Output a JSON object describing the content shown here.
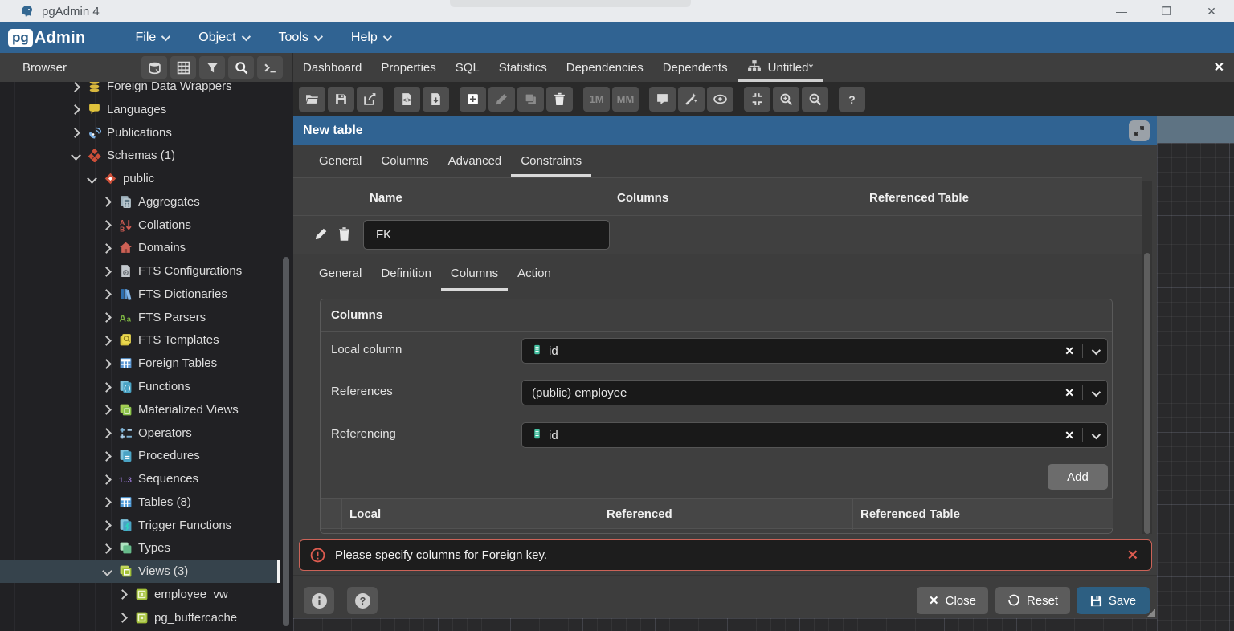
{
  "window": {
    "title": "pgAdmin 4",
    "controls": [
      "minimize",
      "restore",
      "close"
    ]
  },
  "menubar": {
    "logo_pg": "pg",
    "logo_admin": "Admin",
    "menus": [
      "File",
      "Object",
      "Tools",
      "Help"
    ]
  },
  "browser": {
    "title": "Browser",
    "toolbar_icons": [
      "storage-manager-icon",
      "query-table-icon",
      "filter-icon",
      "search-objects-icon",
      "query-tool-icon"
    ],
    "tree": [
      {
        "label": "Foreign Data Wrappers",
        "level": 0,
        "state": "collapsed",
        "icon": "fdw-icon"
      },
      {
        "label": "Languages",
        "level": 0,
        "state": "collapsed",
        "icon": "language-icon"
      },
      {
        "label": "Publications",
        "level": 0,
        "state": "collapsed",
        "icon": "publication-icon"
      },
      {
        "label": "Schemas (1)",
        "level": 0,
        "state": "expanded",
        "icon": "schemas-icon"
      },
      {
        "label": "public",
        "level": 1,
        "state": "expanded",
        "icon": "schema-icon"
      },
      {
        "label": "Aggregates",
        "level": 2,
        "state": "collapsed",
        "icon": "aggregate-icon"
      },
      {
        "label": "Collations",
        "level": 2,
        "state": "collapsed",
        "icon": "collation-icon"
      },
      {
        "label": "Domains",
        "level": 2,
        "state": "collapsed",
        "icon": "domain-icon"
      },
      {
        "label": "FTS Configurations",
        "level": 2,
        "state": "collapsed",
        "icon": "fts-configuration-icon"
      },
      {
        "label": "FTS Dictionaries",
        "level": 2,
        "state": "collapsed",
        "icon": "fts-dictionary-icon"
      },
      {
        "label": "FTS Parsers",
        "level": 2,
        "state": "collapsed",
        "icon": "fts-parser-icon"
      },
      {
        "label": "FTS Templates",
        "level": 2,
        "state": "collapsed",
        "icon": "fts-template-icon"
      },
      {
        "label": "Foreign Tables",
        "level": 2,
        "state": "collapsed",
        "icon": "foreign-table-icon"
      },
      {
        "label": "Functions",
        "level": 2,
        "state": "collapsed",
        "icon": "function-icon"
      },
      {
        "label": "Materialized Views",
        "level": 2,
        "state": "collapsed",
        "icon": "matview-icon"
      },
      {
        "label": "Operators",
        "level": 2,
        "state": "collapsed",
        "icon": "operator-icon"
      },
      {
        "label": "Procedures",
        "level": 2,
        "state": "collapsed",
        "icon": "procedure-icon"
      },
      {
        "label": "Sequences",
        "level": 2,
        "state": "collapsed",
        "icon": "sequence-icon"
      },
      {
        "label": "Tables (8)",
        "level": 2,
        "state": "collapsed",
        "icon": "table-icon"
      },
      {
        "label": "Trigger Functions",
        "level": 2,
        "state": "collapsed",
        "icon": "trigger-function-icon"
      },
      {
        "label": "Types",
        "level": 2,
        "state": "collapsed",
        "icon": "type-icon"
      },
      {
        "label": "Views (3)",
        "level": 2,
        "state": "expanded",
        "icon": "view-collection-icon",
        "selected": true
      },
      {
        "label": "employee_vw",
        "level": 3,
        "state": "collapsed",
        "icon": "view-icon"
      },
      {
        "label": "pg_buffercache",
        "level": 3,
        "state": "collapsed",
        "icon": "view-icon"
      }
    ]
  },
  "main_tabs": {
    "tabs": [
      {
        "label": "Dashboard"
      },
      {
        "label": "Properties"
      },
      {
        "label": "SQL"
      },
      {
        "label": "Statistics"
      },
      {
        "label": "Dependencies"
      },
      {
        "label": "Dependents"
      },
      {
        "label": "Untitled*",
        "active": true,
        "icon": "erd-icon"
      }
    ],
    "close_label": "✕"
  },
  "erd_toolbar": [
    {
      "name": "open-file-icon"
    },
    {
      "name": "save-icon"
    },
    {
      "name": "share-icon",
      "gap_after": true
    },
    {
      "name": "sql-file-icon"
    },
    {
      "name": "download-image-icon",
      "gap_after": true
    },
    {
      "name": "add-table-icon"
    },
    {
      "name": "edit-table-icon",
      "disabled": true
    },
    {
      "name": "clone-table-icon",
      "disabled": true
    },
    {
      "name": "drop-table-icon",
      "gap_after": true
    },
    {
      "name": "one-to-many-icon",
      "text": "1M",
      "disabled": true
    },
    {
      "name": "many-to-many-icon",
      "text": "MM",
      "disabled": true,
      "gap_after": true
    },
    {
      "name": "note-icon"
    },
    {
      "name": "auto-align-icon"
    },
    {
      "name": "show-details-icon",
      "gap_after": true
    },
    {
      "name": "zoom-to-fit-icon"
    },
    {
      "name": "zoom-in-icon"
    },
    {
      "name": "zoom-out-icon",
      "gap_after": true
    },
    {
      "name": "help-icon"
    }
  ],
  "dialog": {
    "title": "New table",
    "tabs": [
      {
        "label": "General"
      },
      {
        "label": "Columns"
      },
      {
        "label": "Advanced"
      },
      {
        "label": "Constraints",
        "active": true
      }
    ],
    "constraints_grid": {
      "headers": [
        "Name",
        "Columns",
        "Referenced Table"
      ],
      "row": {
        "name_value": "FK"
      }
    },
    "fk_tabs": [
      {
        "label": "General"
      },
      {
        "label": "Definition"
      },
      {
        "label": "Columns",
        "active": true
      },
      {
        "label": "Action"
      }
    ],
    "columns_panel": {
      "title": "Columns",
      "fields": [
        {
          "label": "Local column",
          "value": "id",
          "icon": "column-icon"
        },
        {
          "label": "References",
          "value": "(public) employee"
        },
        {
          "label": "Referencing",
          "value": "id",
          "icon": "column-icon"
        }
      ],
      "add_label": "Add",
      "result_headers": [
        "Local",
        "Referenced",
        "Referenced Table"
      ]
    },
    "error": {
      "message": "Please specify columns for Foreign key."
    },
    "footer": {
      "close": "Close",
      "reset": "Reset",
      "save": "Save"
    }
  },
  "colors": {
    "accent_blue": "#306392",
    "error_red": "#cb6358",
    "save_blue": "#2d5f82",
    "selected_row": "#36434c",
    "column_icon_teal": "#45c2a2"
  }
}
